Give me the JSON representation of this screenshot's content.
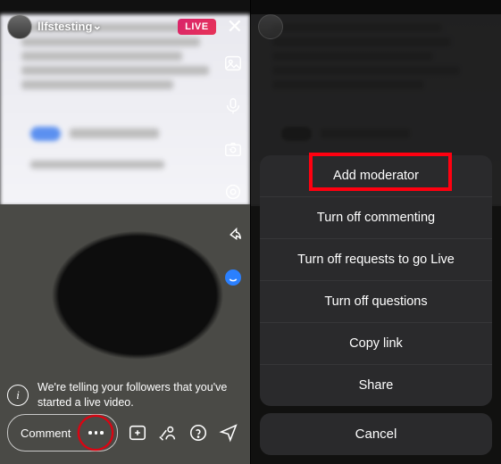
{
  "left": {
    "username": "llfstesting",
    "live_badge": "LIVE",
    "toast": "We're telling your followers that you've started a live video.",
    "comment_label": "Comment"
  },
  "right": {
    "menu": {
      "add_moderator": "Add moderator",
      "turn_off_commenting": "Turn off commenting",
      "turn_off_requests": "Turn off requests to go Live",
      "turn_off_questions": "Turn off questions",
      "copy_link": "Copy link",
      "share": "Share"
    },
    "cancel": "Cancel"
  }
}
